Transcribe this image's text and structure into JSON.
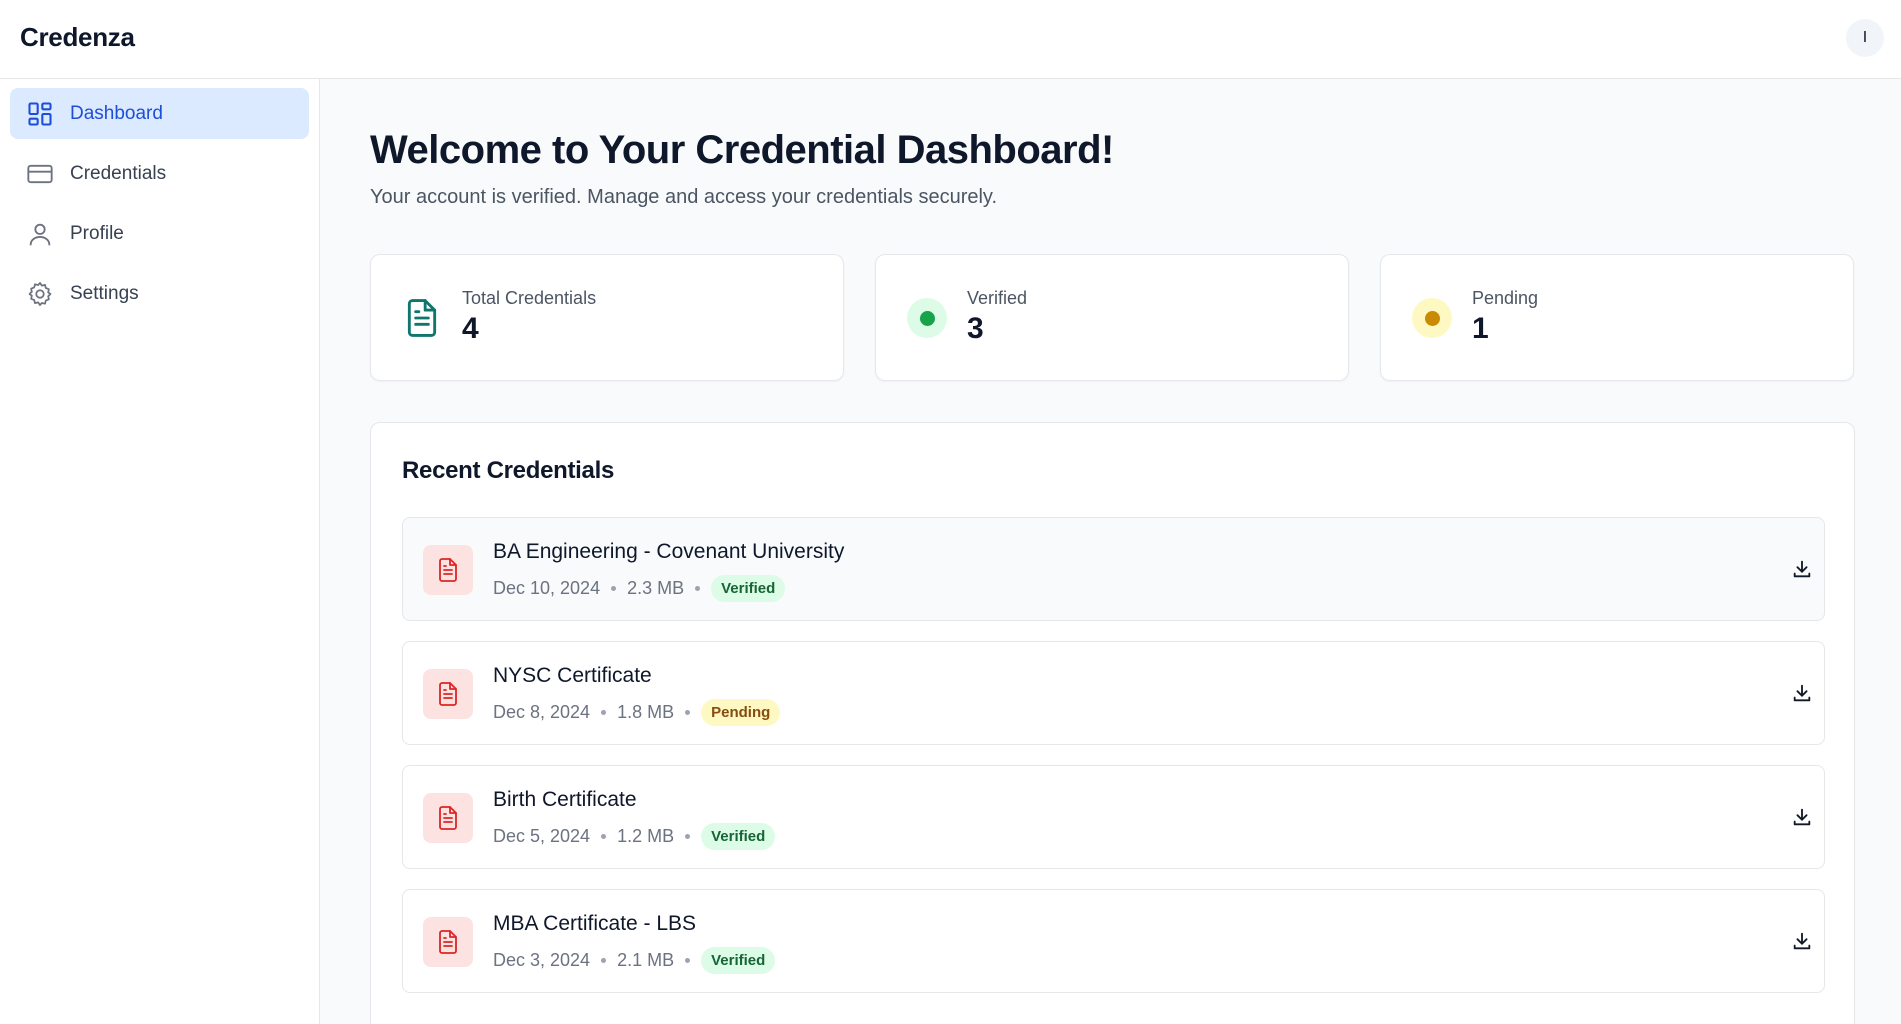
{
  "app": {
    "brand": "Credenza",
    "avatar_initial": "I"
  },
  "sidebar": {
    "items": [
      {
        "label": "Dashboard",
        "icon": "dashboard-grid-icon",
        "active": true
      },
      {
        "label": "Credentials",
        "icon": "credit-card-icon",
        "active": false
      },
      {
        "label": "Profile",
        "icon": "user-icon",
        "active": false
      },
      {
        "label": "Settings",
        "icon": "gear-icon",
        "active": false
      }
    ]
  },
  "main": {
    "title": "Welcome to Your Credential Dashboard!",
    "subtitle": "Your account is verified. Manage and access your credentials securely."
  },
  "stats": [
    {
      "label": "Total Credentials",
      "value": "4",
      "icon": "document-icon",
      "color": "#0f766e"
    },
    {
      "label": "Verified",
      "value": "3",
      "icon": "status-dot-icon",
      "color": "#16a34a",
      "bg": "#dcfce7"
    },
    {
      "label": "Pending",
      "value": "1",
      "icon": "status-dot-icon",
      "color": "#ca8a04",
      "bg": "#fef9c3"
    }
  ],
  "recent": {
    "title": "Recent Credentials",
    "items": [
      {
        "title": "BA Engineering - Covenant University",
        "date": "Dec 10, 2024",
        "size": "2.3 MB",
        "status": "Verified"
      },
      {
        "title": "NYSC Certificate",
        "date": "Dec 8, 2024",
        "size": "1.8 MB",
        "status": "Pending"
      },
      {
        "title": "Birth Certificate",
        "date": "Dec 5, 2024",
        "size": "1.2 MB",
        "status": "Verified"
      },
      {
        "title": "MBA Certificate - LBS",
        "date": "Dec 3, 2024",
        "size": "2.1 MB",
        "status": "Verified"
      }
    ]
  },
  "colors": {
    "accent": "#1d4ed8",
    "active_bg": "#dbeafe",
    "file_icon": "#dc2626",
    "file_icon_bg": "#fde2e2"
  }
}
